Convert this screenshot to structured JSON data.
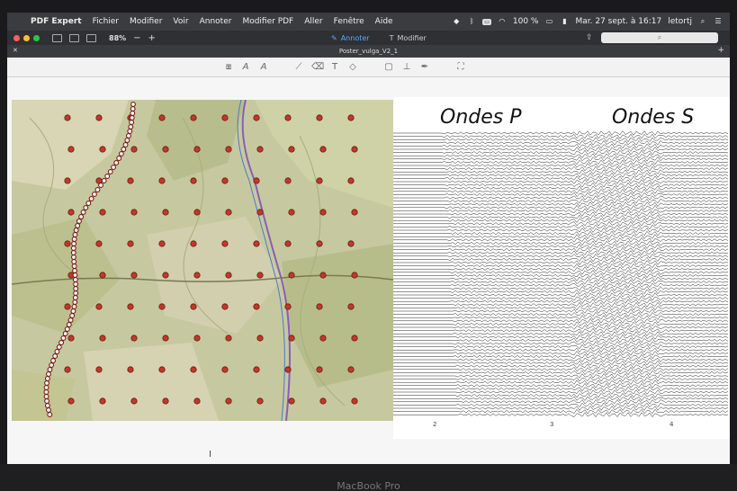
{
  "menubar": {
    "app_name": "PDF Expert",
    "items": [
      "Fichier",
      "Modifier",
      "Voir",
      "Annoter",
      "Modifier PDF",
      "Aller",
      "Fenêtre",
      "Aide"
    ],
    "battery": "100 %",
    "datetime": "Mar. 27 sept. à 16:17",
    "user": "letortj"
  },
  "toolbar": {
    "zoom": "88%",
    "zoom_out": "−",
    "zoom_in": "+",
    "annotate_label": "Annoter",
    "edit_label": "Modifier"
  },
  "tab": {
    "title": "Poster_vulga_V2_1"
  },
  "document": {
    "label_p": "Ondes P",
    "label_s": "Ondes S",
    "axis_ticks": [
      "2",
      "3",
      "4"
    ]
  },
  "device": {
    "label": "MacBook Pro"
  }
}
